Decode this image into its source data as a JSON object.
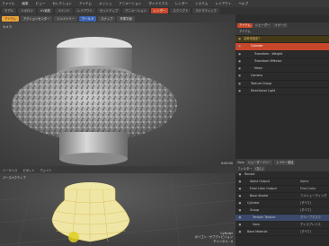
{
  "menubar": {
    "items": [
      "ファイル",
      "編集",
      "ビュー",
      "セレクション",
      "アイテム",
      "メッシュ",
      "アニメーション",
      "ダイナミクス",
      "レンダー",
      "システム",
      "レイアウト",
      "ヘルプ"
    ]
  },
  "tabs": {
    "items": [
      {
        "label": "モデル",
        "active": false
      },
      {
        "label": "トポロジ",
        "active": false
      },
      {
        "label": "UV編集",
        "active": false
      },
      {
        "label": "ペイント",
        "active": false
      },
      {
        "label": "レイアウト",
        "active": false
      },
      {
        "label": "セットアップ",
        "active": false
      },
      {
        "label": "アニメーション",
        "active": false
      },
      {
        "label": "レンダー",
        "active": true
      },
      {
        "label": "スクリプト",
        "active": false
      },
      {
        "label": "スケマティック",
        "active": false
      }
    ]
  },
  "toolbar": {
    "items": [
      {
        "label": "アイテム",
        "style": "accent"
      },
      {
        "label": "アクションセンター",
        "style": "normal"
      },
      {
        "label": "シンメトリー",
        "style": "normal"
      },
      {
        "label": "ワールド",
        "style": "blue"
      },
      {
        "label": "スナップ",
        "style": "normal"
      },
      {
        "label": "作業平面",
        "style": "normal"
      }
    ]
  },
  "viewport_top": {
    "label": "カメラ",
    "status": "0:00:00"
  },
  "right_panel": {
    "tabs": [
      {
        "label": "アイテム",
        "active": true
      },
      {
        "label": "シェーダー",
        "active": false
      },
      {
        "label": "イメージ",
        "active": false
      }
    ],
    "header": "アイテム",
    "tree": [
      {
        "label": "名称未設定*",
        "style": "group",
        "indent": 0
      },
      {
        "label": "Cylinder",
        "style": "selected",
        "indent": 2
      },
      {
        "label": "Transform : Weight",
        "style": "normal",
        "indent": 3
      },
      {
        "label": "Transform Effector",
        "style": "normal",
        "indent": 3
      },
      {
        "label": "Mesh",
        "style": "normal",
        "indent": 3
      },
      {
        "label": "Camera",
        "style": "normal",
        "indent": 2
      },
      {
        "label": "Texture Group",
        "style": "normal",
        "indent": 2
      },
      {
        "label": "Directional Light",
        "style": "normal",
        "indent": 2
      }
    ]
  },
  "shader_panel": {
    "view_label": "View",
    "view_value": "シェーダーツリー",
    "filter_label": "フィルター",
    "filter_value": "(なし)",
    "add_layer_label": "レイヤー追加",
    "rows": [
      {
        "name": "Render",
        "effect": "",
        "indent": 0,
        "hl": false
      },
      {
        "name": "Alpha Output",
        "effect": "Alpha",
        "indent": 2,
        "hl": false
      },
      {
        "name": "Final Color Output",
        "effect": "Final Color",
        "indent": 2,
        "hl": false
      },
      {
        "name": "Base Shader",
        "effect": "フルシェーディング",
        "indent": 2,
        "hl": false
      },
      {
        "name": "Cylinder",
        "effect": "(すべて)",
        "indent": 1,
        "hl": false
      },
      {
        "name": "Group",
        "effect": "(すべて)",
        "indent": 2,
        "hl": false
      },
      {
        "name": "Tension Texture",
        "effect": "グループマスク",
        "indent": 3,
        "hl": true
      },
      {
        "name": "Voxx",
        "effect": "ディスプレイス",
        "indent": 3,
        "hl": false
      },
      {
        "name": "Base Material",
        "effect": "(すべて)",
        "indent": 1,
        "hl": false
      }
    ]
  },
  "bottom_bar": {
    "items": [
      "シーケンス",
      "ピボット",
      "ウェイト"
    ]
  },
  "viewport_bottom": {
    "label": "パースペクティブ",
    "info": [
      "Cylinder",
      "ポリゴン : サブディビジョン",
      "チャンネル : 0"
    ]
  },
  "colors": {
    "accent_orange": "#e8a33a",
    "selected_red": "#c7472b",
    "mesh_yellow": "#e8d36a"
  }
}
